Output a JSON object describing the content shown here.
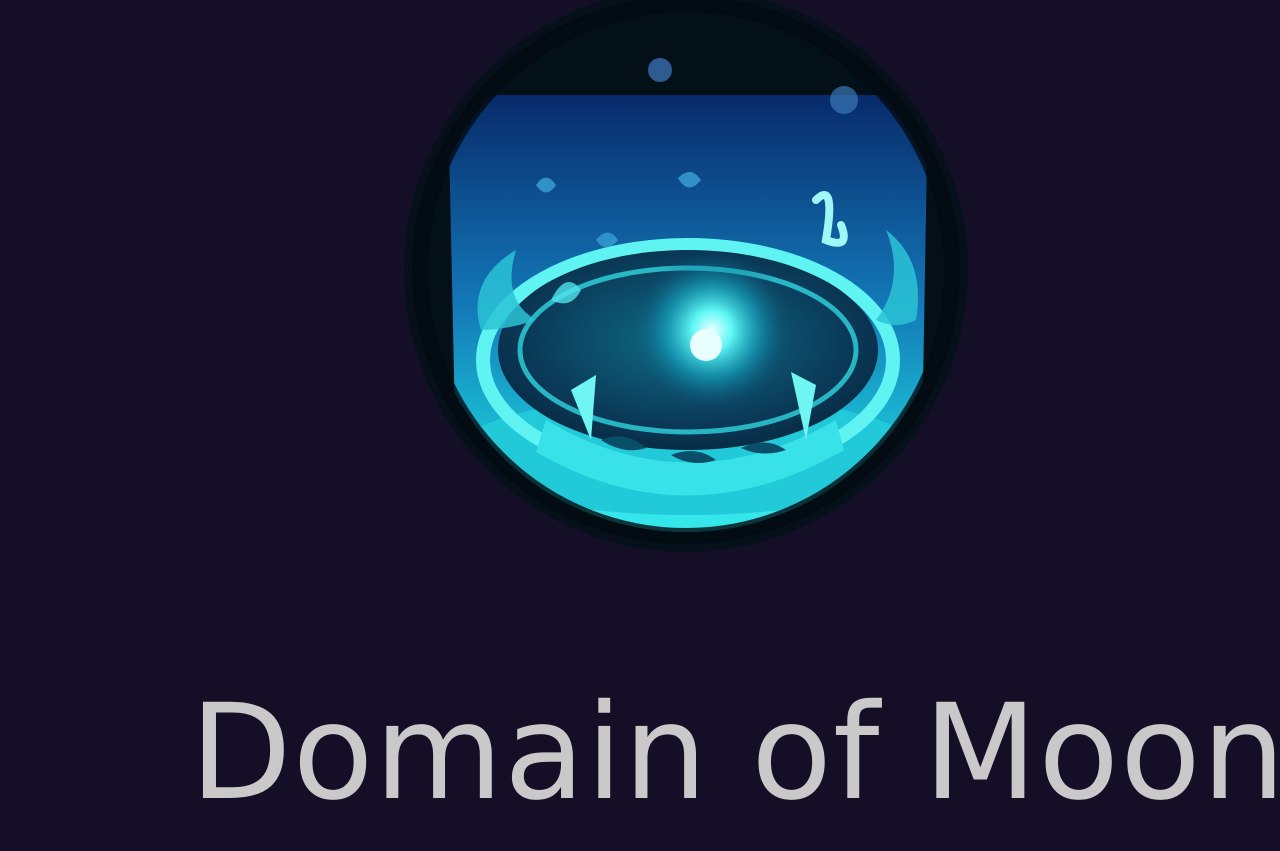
{
  "skill": {
    "name": "Domain of Moon",
    "icon": "moon-domain-icon"
  },
  "colors": {
    "background": "#140f27",
    "text": "#c9c9c9",
    "icon_glow": "#3ff0f0",
    "icon_deep": "#0a2f6a"
  }
}
